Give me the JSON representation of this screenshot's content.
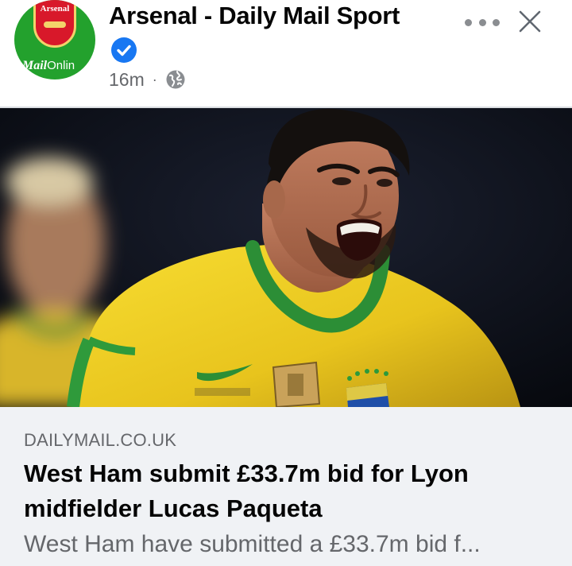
{
  "post": {
    "page_name": "Arsenal - Daily Mail Sport",
    "avatar": {
      "crest_text": "Arsenal",
      "brand_bold": "Mail",
      "brand_rest": "Onlin"
    },
    "timestamp": "16m",
    "separator": "·",
    "audience_icon": "globe-icon",
    "verified_icon": "verified-badge-icon",
    "more_icon": "more-options-icon",
    "close_icon": "close-icon"
  },
  "link_card": {
    "domain": "DAILYMAIL.CO.UK",
    "headline": "West Ham submit £33.7m bid for Lyon midfielder Lucas Paqueta",
    "description": "West Ham have submitted a £33.7m bid f..."
  },
  "colors": {
    "verified": "#1877f2",
    "avatar_bg": "#23a12d",
    "card_bg": "#f0f2f5",
    "secondary_text": "#65676b"
  }
}
